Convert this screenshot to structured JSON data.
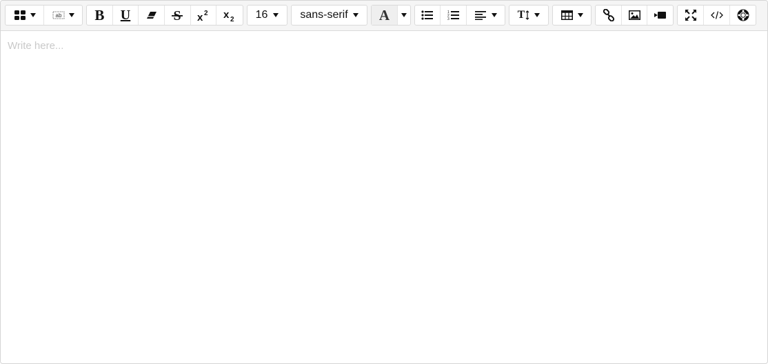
{
  "toolbar": {
    "font_size": "16",
    "font_family": "sans-serif",
    "bold": "B",
    "underline": "U",
    "font_color_letter": "A",
    "line_height_letter": "T"
  },
  "content": {
    "placeholder": "Write here..."
  },
  "icons": [
    "template-icon",
    "format-block-icon",
    "bold-icon",
    "underline-icon",
    "eraser-icon",
    "strikethrough-icon",
    "superscript-icon",
    "subscript-icon",
    "font-color-icon",
    "bullet-list-icon",
    "numbered-list-icon",
    "align-icon",
    "line-height-icon",
    "table-icon",
    "link-icon",
    "image-icon",
    "video-icon",
    "fullscreen-icon",
    "code-view-icon",
    "help-icon"
  ]
}
